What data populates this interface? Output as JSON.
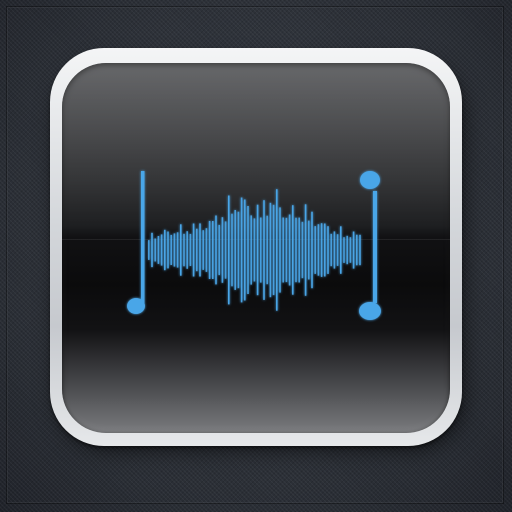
{
  "icon": {
    "name": "audio-waveform-app-icon",
    "accent_color": "#4aa6e8",
    "frame_color": "#d8dbde",
    "background_color": "#2f333b"
  }
}
